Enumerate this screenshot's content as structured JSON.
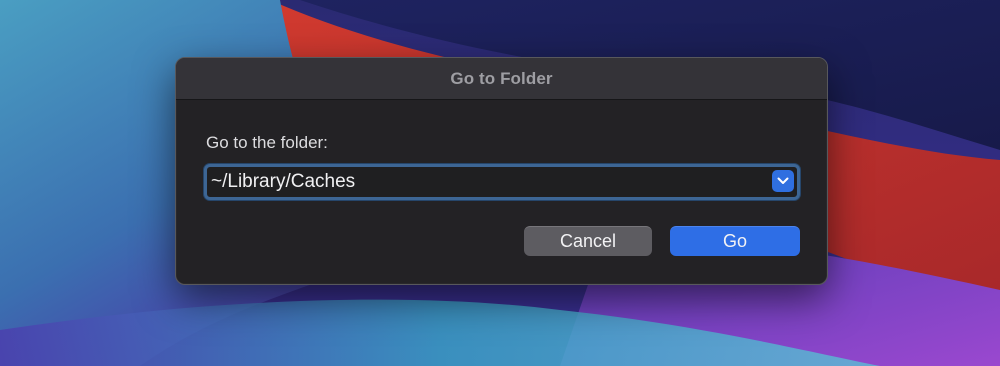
{
  "dialog": {
    "title": "Go to Folder",
    "prompt_label": "Go to the folder:",
    "path_input": {
      "value": "~/Library/Caches",
      "placeholder": ""
    },
    "dropdown_icon": "chevron-down-icon",
    "buttons": {
      "cancel_label": "Cancel",
      "go_label": "Go"
    }
  },
  "colors": {
    "accent": "#2e6ee6",
    "focus_ring": "#3d6695",
    "dialog_background": "#232225",
    "wallpaper_red": "#c4302e",
    "wallpaper_navy": "#1c2055",
    "wallpaper_teal": "#4aa5c6",
    "wallpaper_purple": "#7a3fbe"
  }
}
